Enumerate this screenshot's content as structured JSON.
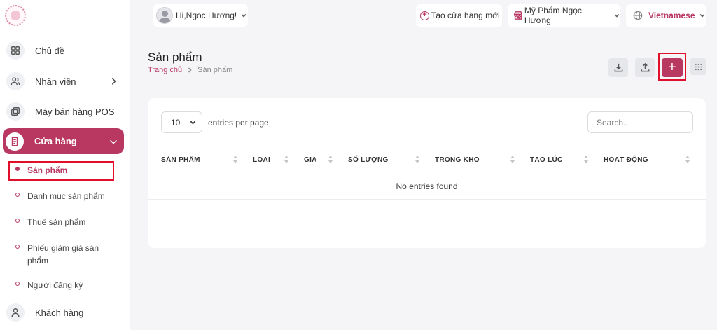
{
  "topbar": {
    "greeting": "Hi,Ngoc Hương!",
    "create_store": "Tạo cửa hàng mới",
    "store_name": "Mỹ Phẩm Ngọc Hương",
    "language": "Vietnamese"
  },
  "sidebar": {
    "items": [
      {
        "label": "Chủ đề",
        "icon": "grid-icon"
      },
      {
        "label": "Nhân viên",
        "icon": "users-icon"
      },
      {
        "label": "Máy bán hàng POS",
        "icon": "pos-icon"
      },
      {
        "label": "Cửa hàng",
        "icon": "store-doc-icon"
      },
      {
        "label": "Khách hàng",
        "icon": "user-icon"
      }
    ],
    "subitems": [
      {
        "label": "Sản phẩm"
      },
      {
        "label": "Danh mục sản phẩm"
      },
      {
        "label": "Thuế sản phẩm"
      },
      {
        "label": "Phiếu giảm giá sản phẩm"
      },
      {
        "label": "Người đăng ký"
      }
    ]
  },
  "page": {
    "title": "Sản phẩm",
    "breadcrumb_home": "Trang chủ",
    "breadcrumb_current": "Sản phẩm",
    "add_label": "+"
  },
  "table": {
    "per_page": "10",
    "entries_label": "entries per page",
    "search_placeholder": "Search...",
    "columns": [
      "SẢN PHẨM",
      "LOẠI",
      "GIÁ",
      "SỐ LƯỢNG",
      "TRONG KHO",
      "TẠO LÚC",
      "HOẠT ĐỘNG"
    ],
    "empty": "No entries found"
  },
  "colors": {
    "accent": "#b83862",
    "highlight_box": "#e0102d"
  }
}
